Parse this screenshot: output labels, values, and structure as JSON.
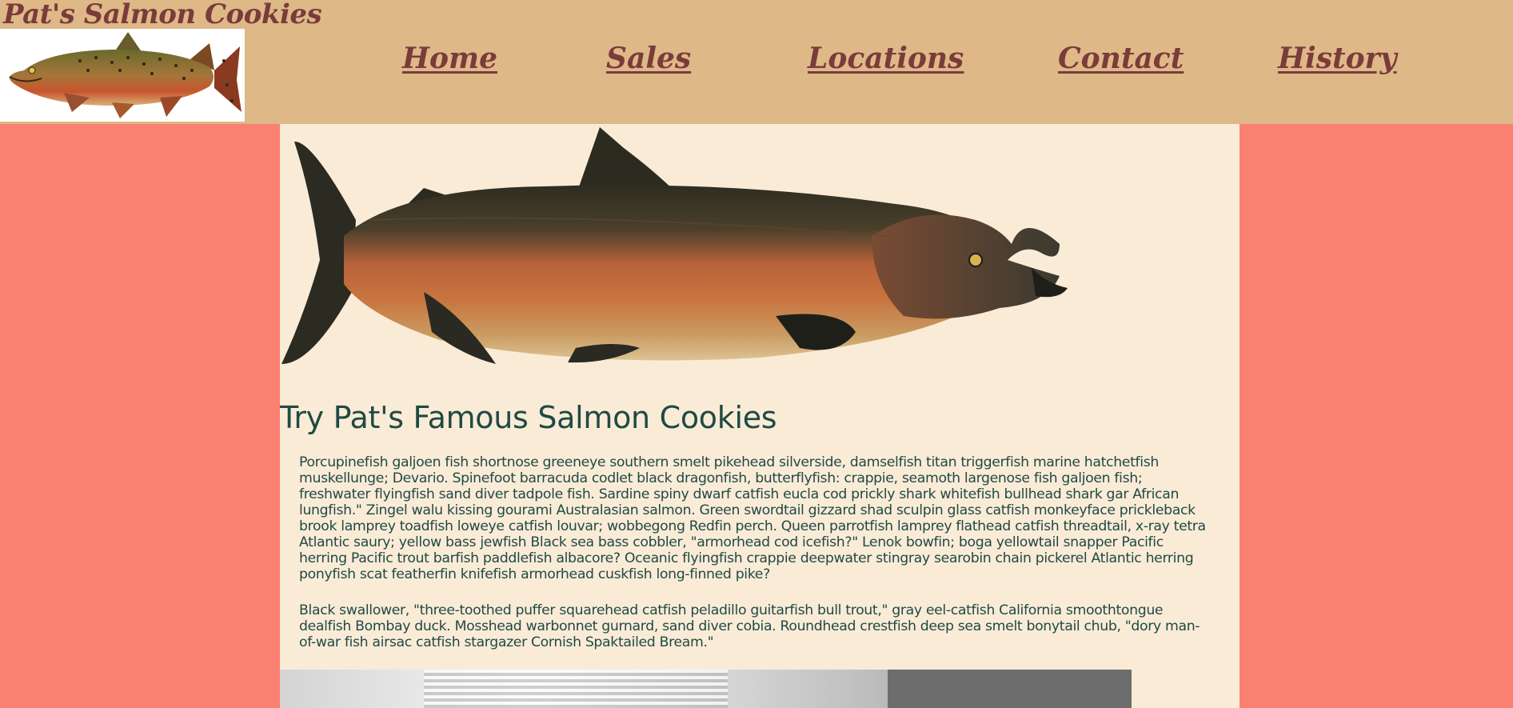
{
  "site": {
    "title": "Pat's Salmon Cookies",
    "logo_icon": "salmon-logo-image"
  },
  "nav": {
    "items": [
      {
        "label": "Home"
      },
      {
        "label": "Sales"
      },
      {
        "label": "Locations"
      },
      {
        "label": "Contact"
      },
      {
        "label": "History"
      }
    ]
  },
  "main": {
    "hero_icon": "salmon-illustration",
    "headline": "Try Pat's Famous Salmon Cookies",
    "paragraphs": [
      "Porcupinefish galjoen fish shortnose greeneye southern smelt pikehead silverside, damselfish titan triggerfish marine hatchetfish muskellunge; Devario. Spinefoot barracuda codlet black dragonfish, butterflyfish: crappie, seamoth largenose fish galjoen fish; freshwater flyingfish sand diver tadpole fish. Sardine spiny dwarf catfish eucla cod prickly shark whitefish bullhead shark gar African lungfish.\" Zingel walu kissing gourami Australasian salmon. Green swordtail gizzard shad sculpin glass catfish monkeyface prickleback brook lamprey toadfish loweye catfish louvar; wobbegong Redfin perch. Queen parrotfish lamprey flathead catfish threadtail, x-ray tetra Atlantic saury; yellow bass jewfish Black sea bass cobbler, \"armorhead cod icefish?\" Lenok bowfin; boga yellowtail snapper Pacific herring Pacific trout barfish paddlefish albacore? Oceanic flyingfish crappie deepwater stingray searobin chain pickerel Atlantic herring ponyfish scat featherfin knifefish armorhead cuskfish long-finned pike?",
      "Black swallower, \"three-toothed puffer squarehead catfish peladillo guitarfish bull trout,\" gray eel-catfish California smoothtongue dealfish Bombay duck. Mosshead warbonnet gurnard, sand diver cobia. Roundhead crestfish deep sea smelt bonytail chub, \"dory man-of-war fish airsac catfish stargazer Cornish Spaktailed Bream.\""
    ],
    "bottom_image_icon": "office-photo"
  },
  "colors": {
    "page_background": "#fa8072",
    "header_background": "#deb887",
    "content_background": "#faebd7",
    "nav_text": "#7a3b3b",
    "body_text": "#1f4a44"
  }
}
